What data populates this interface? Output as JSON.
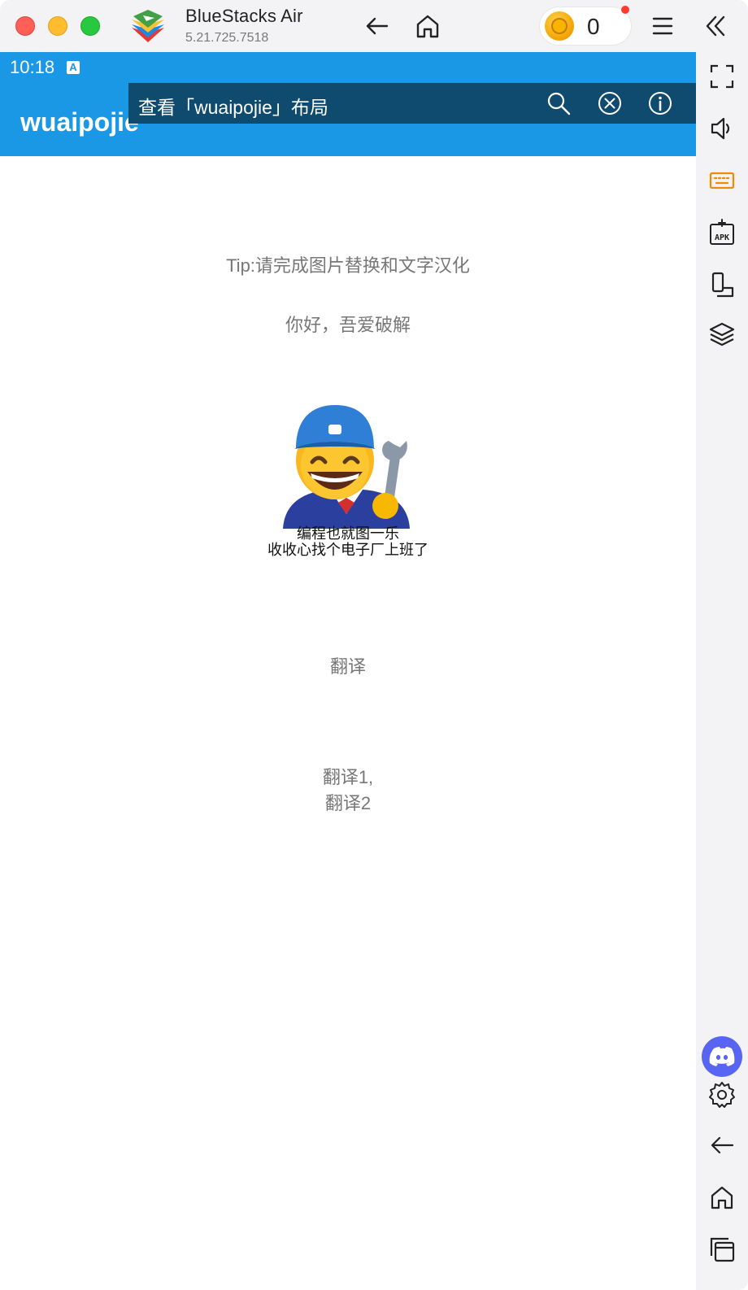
{
  "titlebar": {
    "app_name": "BlueStacks Air",
    "version": "5.21.725.7518",
    "coin_count": "0"
  },
  "statusbar": {
    "time": "10:18",
    "notification_glyph": "A"
  },
  "appbar": {
    "title": "wuaipojie"
  },
  "inspector": {
    "label": "查看「wuaipojie」布局"
  },
  "content": {
    "tip": "Tip:请完成图片替换和文字汉化",
    "greeting": "你好，吾爱破解",
    "meme_caption_line1": "编程也就图一乐",
    "meme_caption_line2": "收收心找个电子厂上班了",
    "translate_label": "翻译",
    "translate_result_line1": "翻译1,",
    "translate_result_line2": "翻译2"
  },
  "colors": {
    "accent": "#1a98e6",
    "inspector_bg": "#0f4a6f",
    "discord": "#5865f2"
  },
  "icons": {
    "titlebar": [
      "back-arrow-icon",
      "home-icon",
      "coin-icon",
      "menu-icon",
      "collapse-double-chevron-icon"
    ],
    "sidebar": [
      "fullscreen-icon",
      "volume-icon",
      "keyboard-icon",
      "install-apk-icon",
      "rotate-device-icon",
      "layers-icon",
      "discord-icon",
      "settings-gear-icon",
      "back-arrow-icon",
      "home-icon",
      "recent-apps-icon"
    ],
    "inspector": [
      "search-icon",
      "close-circle-icon",
      "info-icon"
    ]
  }
}
